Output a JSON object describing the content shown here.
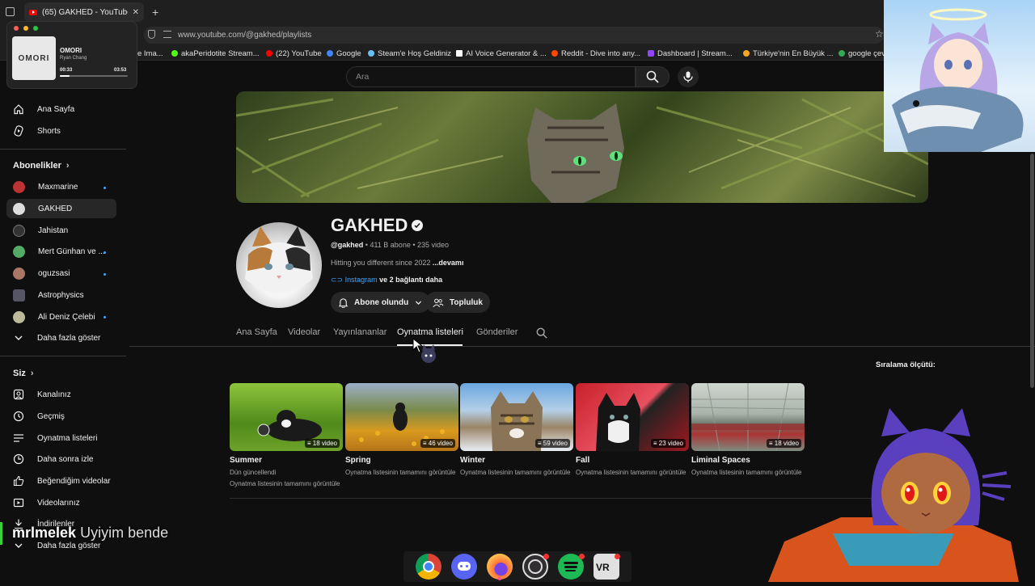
{
  "browser": {
    "tab_title": "(65) GAKHED - YouTube",
    "new_tab_symbol": "+",
    "url": "www.youtube.com/@gakhed/playlists",
    "bookmarks": [
      {
        "label": "e Ima...",
        "color": "#9aa0a6"
      },
      {
        "label": "akaPeridotite Stream...",
        "color": "#53fc18"
      },
      {
        "label": "(22) YouTube",
        "color": "#ff0000"
      },
      {
        "label": "Google",
        "color": "#4285f4"
      },
      {
        "label": "Steam'e Hoş Geldiniz",
        "color": "#66c0f4"
      },
      {
        "label": "AI Voice Generator & ...",
        "color": "#ffffff"
      },
      {
        "label": "Reddit - Dive into any...",
        "color": "#ff4500"
      },
      {
        "label": "Dashboard | Stream...",
        "color": "#9146ff"
      },
      {
        "label": "Türkiye'nin En Büyük ...",
        "color": "#f5a623"
      },
      {
        "label": "google çev",
        "color": "#34a853"
      }
    ]
  },
  "media": {
    "title": "OMORI",
    "artist": "Ryan Chang",
    "elapsed": "00:33",
    "duration": "03:53",
    "progress": 0.14,
    "cover_text": "OMORI"
  },
  "search": {
    "placeholder": "Ara"
  },
  "sidebar": {
    "main": [
      {
        "label": "Ana Sayfa",
        "icon": "home-icon"
      },
      {
        "label": "Shorts",
        "icon": "shorts-icon"
      }
    ],
    "subs_header": "Abonelikler",
    "subs": [
      {
        "label": "Maxmarine",
        "color": "#b33",
        "new": true
      },
      {
        "label": "GAKHED",
        "color": "#ddd",
        "new": false
      },
      {
        "label": "Jahistan",
        "color": "#333",
        "new": false
      },
      {
        "label": "Mert Günhan ve ...",
        "color": "#5a6",
        "new": true
      },
      {
        "label": "oguzsasi",
        "color": "#a76",
        "new": true
      },
      {
        "label": "Astrophysics",
        "color": "#556",
        "new": false
      },
      {
        "label": "Ali Deniz Çelebi",
        "color": "#bb9",
        "new": true
      }
    ],
    "subs_more": "Daha fazla göster",
    "you_header": "Siz",
    "you": [
      {
        "label": "Kanalınız",
        "icon": "channel-icon"
      },
      {
        "label": "Geçmiş",
        "icon": "history-icon"
      },
      {
        "label": "Oynatma listeleri",
        "icon": "playlists-icon"
      },
      {
        "label": "Daha sonra izle",
        "icon": "watch-later-icon"
      },
      {
        "label": "Beğendiğim videolar",
        "icon": "like-icon"
      },
      {
        "label": "Videolarınız",
        "icon": "your-videos-icon"
      },
      {
        "label": "İndirilenler",
        "icon": "download-icon"
      }
    ],
    "you_more": "Daha fazla göster"
  },
  "channel": {
    "name": "GAKHED",
    "handle": "@gakhed",
    "meta": " • 411 B abone • 235 video",
    "desc": "Hitting you different since 2022 ",
    "desc_more": "...devamı",
    "link": "Instagram",
    "link_more": " ve 2 bağlantı daha",
    "subscribed_label": "Abone olundu",
    "community_label": "Topluluk",
    "tabs": [
      "Ana Sayfa",
      "Videolar",
      "Yayınlananlar",
      "Oynatma listeleri",
      "Gönderiler"
    ],
    "selected_tab": 3
  },
  "sort_label": "Sıralama ölçütü:",
  "playlists": [
    {
      "title": "Summer",
      "sub1": "Dün güncellendi",
      "sub2": "Oynatma listesinin tamamını görüntüle",
      "count": "18 video",
      "bg": "linear-gradient(180deg,#8fc43c,#4f8a1a 60%,#6ea32a)"
    },
    {
      "title": "Spring",
      "sub1": "Oynatma listesinin tamamını görüntüle",
      "sub2": "",
      "count": "46 video",
      "bg": "linear-gradient(180deg,#9ab0c8,#7a8a4a 40%,#d99a1e 70%,#b5741a)"
    },
    {
      "title": "Winter",
      "sub1": "Oynatma listesinin tamamını görüntüle",
      "sub2": "",
      "count": "59 video",
      "bg": "linear-gradient(180deg,#6aa7e0,#b4cfe8 40%,#9b8466 65%,#e8eef4)"
    },
    {
      "title": "Fall",
      "sub1": "Oynatma listesinin tamamını görüntüle",
      "sub2": "",
      "count": "23 video",
      "bg": "linear-gradient(135deg,#c8202a,#e85060 50%,#222 55%,#a01820)"
    },
    {
      "title": "Liminal Spaces",
      "sub1": "Oynatma listesinin tamamını görüntüle",
      "sub2": "",
      "count": "18 video",
      "bg": "linear-gradient(180deg,#cfd6d0,#a9b3aa 45%,#6e7a70 60%,#a33 75%,#7d8b80)"
    }
  ],
  "overlay": {
    "chat_user": "mrlmelek",
    "chat_msg": "Uyiyim bende"
  },
  "taskbar": [
    {
      "name": "chrome-icon",
      "color": "#db4437"
    },
    {
      "name": "discord-icon",
      "color": "#5865f2"
    },
    {
      "name": "firefox-icon",
      "color": "#ff7139"
    },
    {
      "name": "obs-icon",
      "color": "#302e31"
    },
    {
      "name": "spotify-icon",
      "color": "#1db954"
    },
    {
      "name": "vr-icon",
      "color": "#444"
    }
  ]
}
